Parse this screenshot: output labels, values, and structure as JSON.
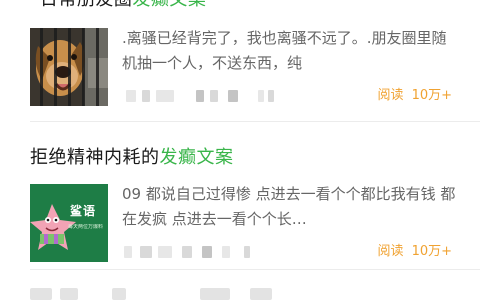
{
  "articles": [
    {
      "title_prefix": "“日常朋友圈",
      "title_highlight": "发癫文案",
      "excerpt": ".离骚已经背完了，我也离骚不远了。.朋友圈里随机抽一个人，不送东西，纯",
      "reads_label": "阅读",
      "reads_value": "10万+",
      "thumbnail_icon": "dog-photo-thumbnail"
    },
    {
      "title_prefix": "拒绝精神内耗的",
      "title_highlight": "发癫文案",
      "excerpt": "09 都说自己过得惨 点进去一看个个都比我有钱 都在发疯 点进去一看个个长…",
      "reads_label": "阅读",
      "reads_value": "10万+",
      "thumbnail_icon": "patrick-star-thumbnail",
      "thumbnail_text": "鲨语",
      "thumbnail_subtext": "每天两位万爆料"
    }
  ],
  "colors": {
    "highlight": "#39b54a",
    "reads": "#f0a231",
    "text": "#1a1a1a",
    "excerpt": "#666666"
  }
}
